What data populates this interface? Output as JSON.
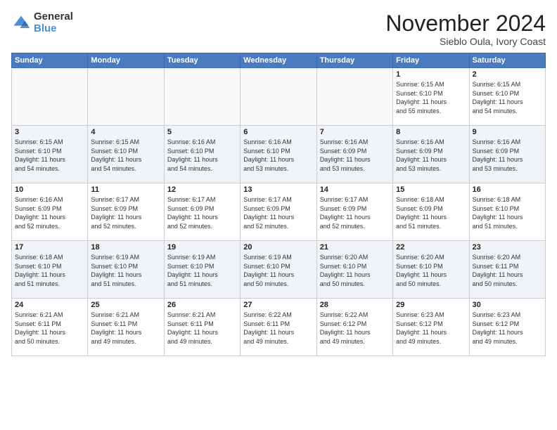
{
  "header": {
    "logo_general": "General",
    "logo_blue": "Blue",
    "month_title": "November 2024",
    "location": "Sieblo Oula, Ivory Coast"
  },
  "weekdays": [
    "Sunday",
    "Monday",
    "Tuesday",
    "Wednesday",
    "Thursday",
    "Friday",
    "Saturday"
  ],
  "weeks": [
    [
      {
        "day": "",
        "info": ""
      },
      {
        "day": "",
        "info": ""
      },
      {
        "day": "",
        "info": ""
      },
      {
        "day": "",
        "info": ""
      },
      {
        "day": "",
        "info": ""
      },
      {
        "day": "1",
        "info": "Sunrise: 6:15 AM\nSunset: 6:10 PM\nDaylight: 11 hours\nand 55 minutes."
      },
      {
        "day": "2",
        "info": "Sunrise: 6:15 AM\nSunset: 6:10 PM\nDaylight: 11 hours\nand 54 minutes."
      }
    ],
    [
      {
        "day": "3",
        "info": "Sunrise: 6:15 AM\nSunset: 6:10 PM\nDaylight: 11 hours\nand 54 minutes."
      },
      {
        "day": "4",
        "info": "Sunrise: 6:15 AM\nSunset: 6:10 PM\nDaylight: 11 hours\nand 54 minutes."
      },
      {
        "day": "5",
        "info": "Sunrise: 6:16 AM\nSunset: 6:10 PM\nDaylight: 11 hours\nand 54 minutes."
      },
      {
        "day": "6",
        "info": "Sunrise: 6:16 AM\nSunset: 6:10 PM\nDaylight: 11 hours\nand 53 minutes."
      },
      {
        "day": "7",
        "info": "Sunrise: 6:16 AM\nSunset: 6:09 PM\nDaylight: 11 hours\nand 53 minutes."
      },
      {
        "day": "8",
        "info": "Sunrise: 6:16 AM\nSunset: 6:09 PM\nDaylight: 11 hours\nand 53 minutes."
      },
      {
        "day": "9",
        "info": "Sunrise: 6:16 AM\nSunset: 6:09 PM\nDaylight: 11 hours\nand 53 minutes."
      }
    ],
    [
      {
        "day": "10",
        "info": "Sunrise: 6:16 AM\nSunset: 6:09 PM\nDaylight: 11 hours\nand 52 minutes."
      },
      {
        "day": "11",
        "info": "Sunrise: 6:17 AM\nSunset: 6:09 PM\nDaylight: 11 hours\nand 52 minutes."
      },
      {
        "day": "12",
        "info": "Sunrise: 6:17 AM\nSunset: 6:09 PM\nDaylight: 11 hours\nand 52 minutes."
      },
      {
        "day": "13",
        "info": "Sunrise: 6:17 AM\nSunset: 6:09 PM\nDaylight: 11 hours\nand 52 minutes."
      },
      {
        "day": "14",
        "info": "Sunrise: 6:17 AM\nSunset: 6:09 PM\nDaylight: 11 hours\nand 52 minutes."
      },
      {
        "day": "15",
        "info": "Sunrise: 6:18 AM\nSunset: 6:09 PM\nDaylight: 11 hours\nand 51 minutes."
      },
      {
        "day": "16",
        "info": "Sunrise: 6:18 AM\nSunset: 6:10 PM\nDaylight: 11 hours\nand 51 minutes."
      }
    ],
    [
      {
        "day": "17",
        "info": "Sunrise: 6:18 AM\nSunset: 6:10 PM\nDaylight: 11 hours\nand 51 minutes."
      },
      {
        "day": "18",
        "info": "Sunrise: 6:19 AM\nSunset: 6:10 PM\nDaylight: 11 hours\nand 51 minutes."
      },
      {
        "day": "19",
        "info": "Sunrise: 6:19 AM\nSunset: 6:10 PM\nDaylight: 11 hours\nand 51 minutes."
      },
      {
        "day": "20",
        "info": "Sunrise: 6:19 AM\nSunset: 6:10 PM\nDaylight: 11 hours\nand 50 minutes."
      },
      {
        "day": "21",
        "info": "Sunrise: 6:20 AM\nSunset: 6:10 PM\nDaylight: 11 hours\nand 50 minutes."
      },
      {
        "day": "22",
        "info": "Sunrise: 6:20 AM\nSunset: 6:10 PM\nDaylight: 11 hours\nand 50 minutes."
      },
      {
        "day": "23",
        "info": "Sunrise: 6:20 AM\nSunset: 6:11 PM\nDaylight: 11 hours\nand 50 minutes."
      }
    ],
    [
      {
        "day": "24",
        "info": "Sunrise: 6:21 AM\nSunset: 6:11 PM\nDaylight: 11 hours\nand 50 minutes."
      },
      {
        "day": "25",
        "info": "Sunrise: 6:21 AM\nSunset: 6:11 PM\nDaylight: 11 hours\nand 49 minutes."
      },
      {
        "day": "26",
        "info": "Sunrise: 6:21 AM\nSunset: 6:11 PM\nDaylight: 11 hours\nand 49 minutes."
      },
      {
        "day": "27",
        "info": "Sunrise: 6:22 AM\nSunset: 6:11 PM\nDaylight: 11 hours\nand 49 minutes."
      },
      {
        "day": "28",
        "info": "Sunrise: 6:22 AM\nSunset: 6:12 PM\nDaylight: 11 hours\nand 49 minutes."
      },
      {
        "day": "29",
        "info": "Sunrise: 6:23 AM\nSunset: 6:12 PM\nDaylight: 11 hours\nand 49 minutes."
      },
      {
        "day": "30",
        "info": "Sunrise: 6:23 AM\nSunset: 6:12 PM\nDaylight: 11 hours\nand 49 minutes."
      }
    ]
  ]
}
